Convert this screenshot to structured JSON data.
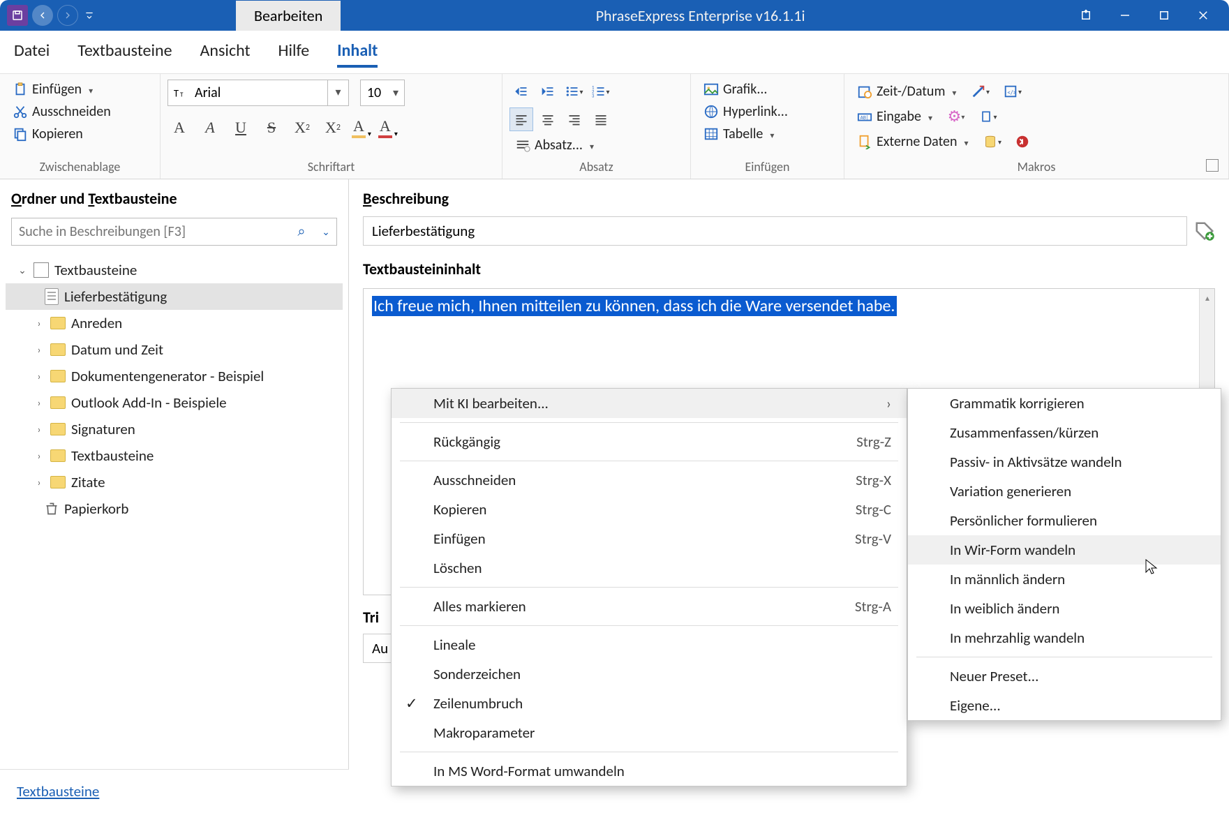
{
  "title": "PhraseExpress Enterprise v16.1.1i",
  "activeTab": "Bearbeiten",
  "menuTabs": [
    "Datei",
    "Textbausteine",
    "Ansicht",
    "Hilfe",
    "Inhalt"
  ],
  "activeMenuTab": "Inhalt",
  "ribbon": {
    "clipboard": {
      "label": "Zwischenablage",
      "paste": "Einfügen",
      "cut": "Ausschneiden",
      "copy": "Kopieren"
    },
    "font": {
      "label": "Schriftart",
      "name": "Arial",
      "size": "10"
    },
    "paragraph": {
      "label": "Absatz",
      "btn": "Absatz..."
    },
    "insert": {
      "label": "Einfügen",
      "graphic": "Grafik...",
      "hyperlink": "Hyperlink...",
      "table": "Tabelle"
    },
    "macros": {
      "label": "Makros",
      "datetime": "Zeit-/Datum",
      "input": "Eingabe",
      "extdata": "Externe Daten"
    }
  },
  "sidebar": {
    "heading": "Ordner und Textbausteine",
    "searchPlaceholder": "Suche in Beschreibungen [F3]",
    "root": "Textbausteine",
    "selected": "Lieferbestätigung",
    "folders": [
      "Anreden",
      "Datum und Zeit",
      "Dokumentengenerator - Beispiel",
      "Outlook Add-In - Beispiele",
      "Signaturen",
      "Textbausteine",
      "Zitate"
    ],
    "trash": "Papierkorb",
    "footer": "Textbausteine"
  },
  "main": {
    "descLabel": "Beschreibung",
    "descValue": "Lieferbestätigung",
    "contentLabel": "Textbausteininhalt",
    "content": "Ich freue mich, Ihnen mitteilen zu können, dass ich die Ware versendet habe.",
    "trigLabel": "Tri",
    "trigValue": "Au"
  },
  "contextMenu1": {
    "items": [
      {
        "label": "Mit KI bearbeiten...",
        "sub": true,
        "hov": true
      },
      {
        "sep": true
      },
      {
        "label": "Rückgängig",
        "short": "Strg-Z"
      },
      {
        "sep": true
      },
      {
        "label": "Ausschneiden",
        "short": "Strg-X"
      },
      {
        "label": "Kopieren",
        "short": "Strg-C"
      },
      {
        "label": "Einfügen",
        "short": "Strg-V"
      },
      {
        "label": "Löschen"
      },
      {
        "sep": true
      },
      {
        "label": "Alles markieren",
        "short": "Strg-A"
      },
      {
        "sep": true
      },
      {
        "label": "Lineale"
      },
      {
        "label": "Sonderzeichen"
      },
      {
        "label": "Zeilenumbruch",
        "check": true
      },
      {
        "label": "Makroparameter"
      },
      {
        "sep": true
      },
      {
        "label": "In MS Word-Format umwandeln"
      }
    ]
  },
  "contextMenu2": {
    "items": [
      {
        "label": "Grammatik korrigieren"
      },
      {
        "label": "Zusammenfassen/kürzen"
      },
      {
        "label": "Passiv- in Aktivsätze wandeln"
      },
      {
        "label": "Variation generieren"
      },
      {
        "label": "Persönlicher formulieren"
      },
      {
        "label": "In Wir-Form wandeln",
        "hov": true
      },
      {
        "label": "In männlich ändern"
      },
      {
        "label": "In weiblich ändern"
      },
      {
        "label": "In mehrzahlig wandeln"
      },
      {
        "sep": true
      },
      {
        "label": "Neuer Preset..."
      },
      {
        "label": "Eigene..."
      }
    ]
  }
}
